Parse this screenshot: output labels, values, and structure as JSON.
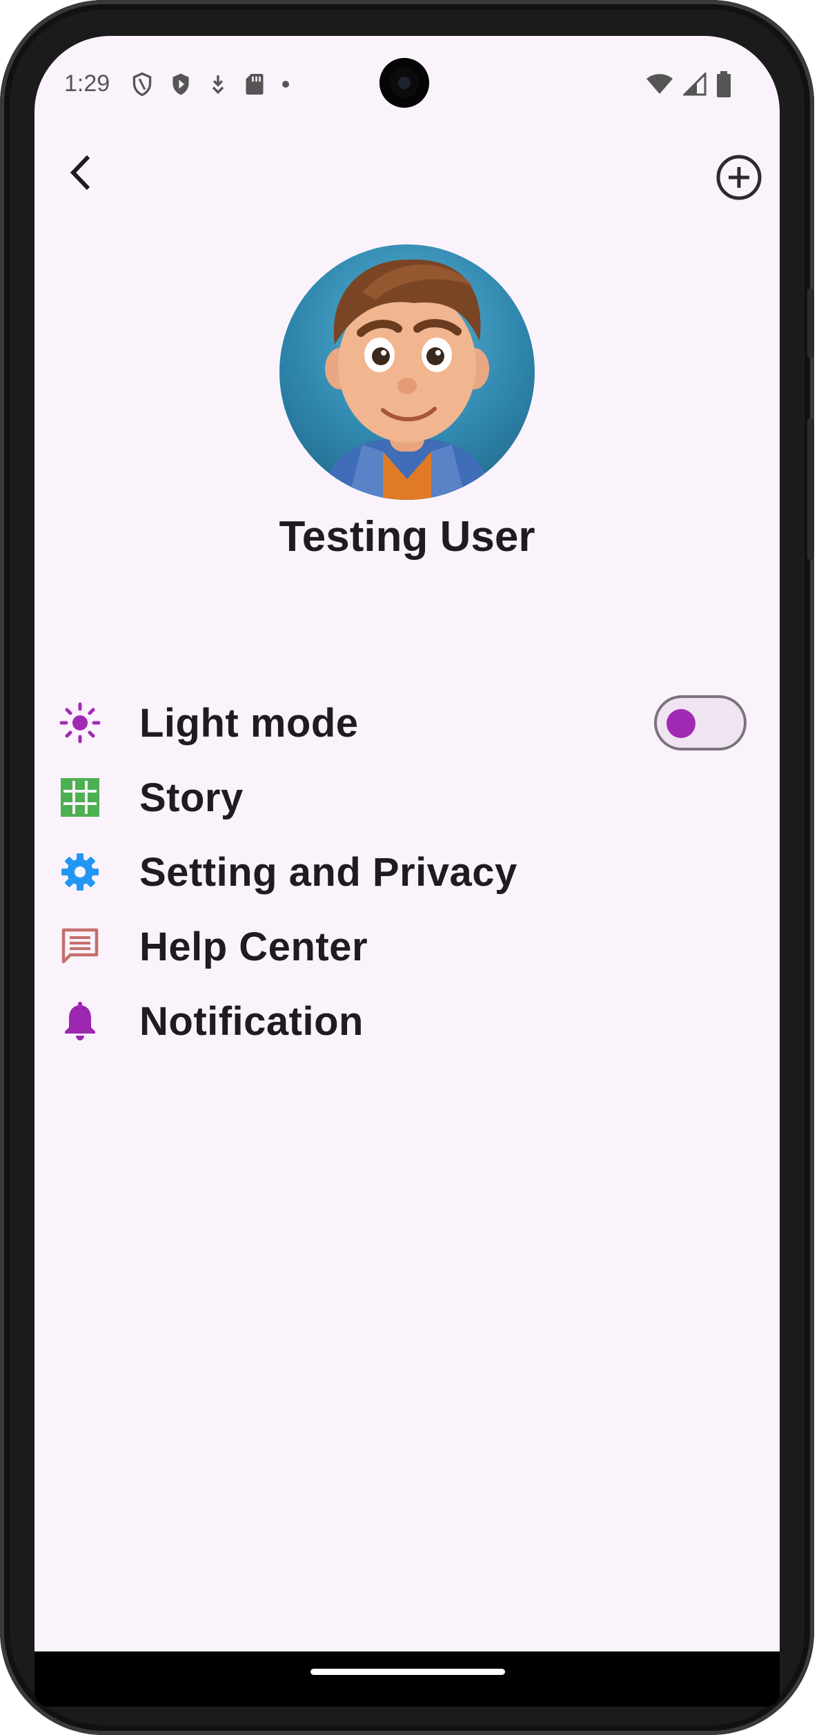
{
  "status_bar": {
    "time": "1:29",
    "left_icons": [
      "shield-outline-icon",
      "shield-play-icon",
      "download-icon",
      "sd-card-icon",
      "dot-icon"
    ],
    "right_icons": [
      "wifi-icon",
      "cell-signal-icon",
      "battery-icon"
    ]
  },
  "app_bar": {
    "back_icon": "chevron-left-icon",
    "add_icon": "add-circle-icon"
  },
  "profile": {
    "name": "Testing User"
  },
  "menu": {
    "items": [
      {
        "label": "Light mode",
        "icon": "sun-icon",
        "icon_color": "#a12ab4",
        "has_toggle": true
      },
      {
        "label": "Story",
        "icon": "grid-icon",
        "icon_color": "#4caf50"
      },
      {
        "label": "Setting and Privacy",
        "icon": "gear-icon",
        "icon_color": "#2196f3"
      },
      {
        "label": "Help Center",
        "icon": "chat-icon",
        "icon_color": "#c4706c"
      },
      {
        "label": "Notification",
        "icon": "bell-icon",
        "icon_color": "#9c27b0"
      }
    ],
    "light_mode_toggle": {
      "on": true,
      "active_color": "#a12ab4"
    }
  },
  "colors": {
    "screen_background": "#fbf3fb",
    "text_primary": "#1e1b22"
  }
}
